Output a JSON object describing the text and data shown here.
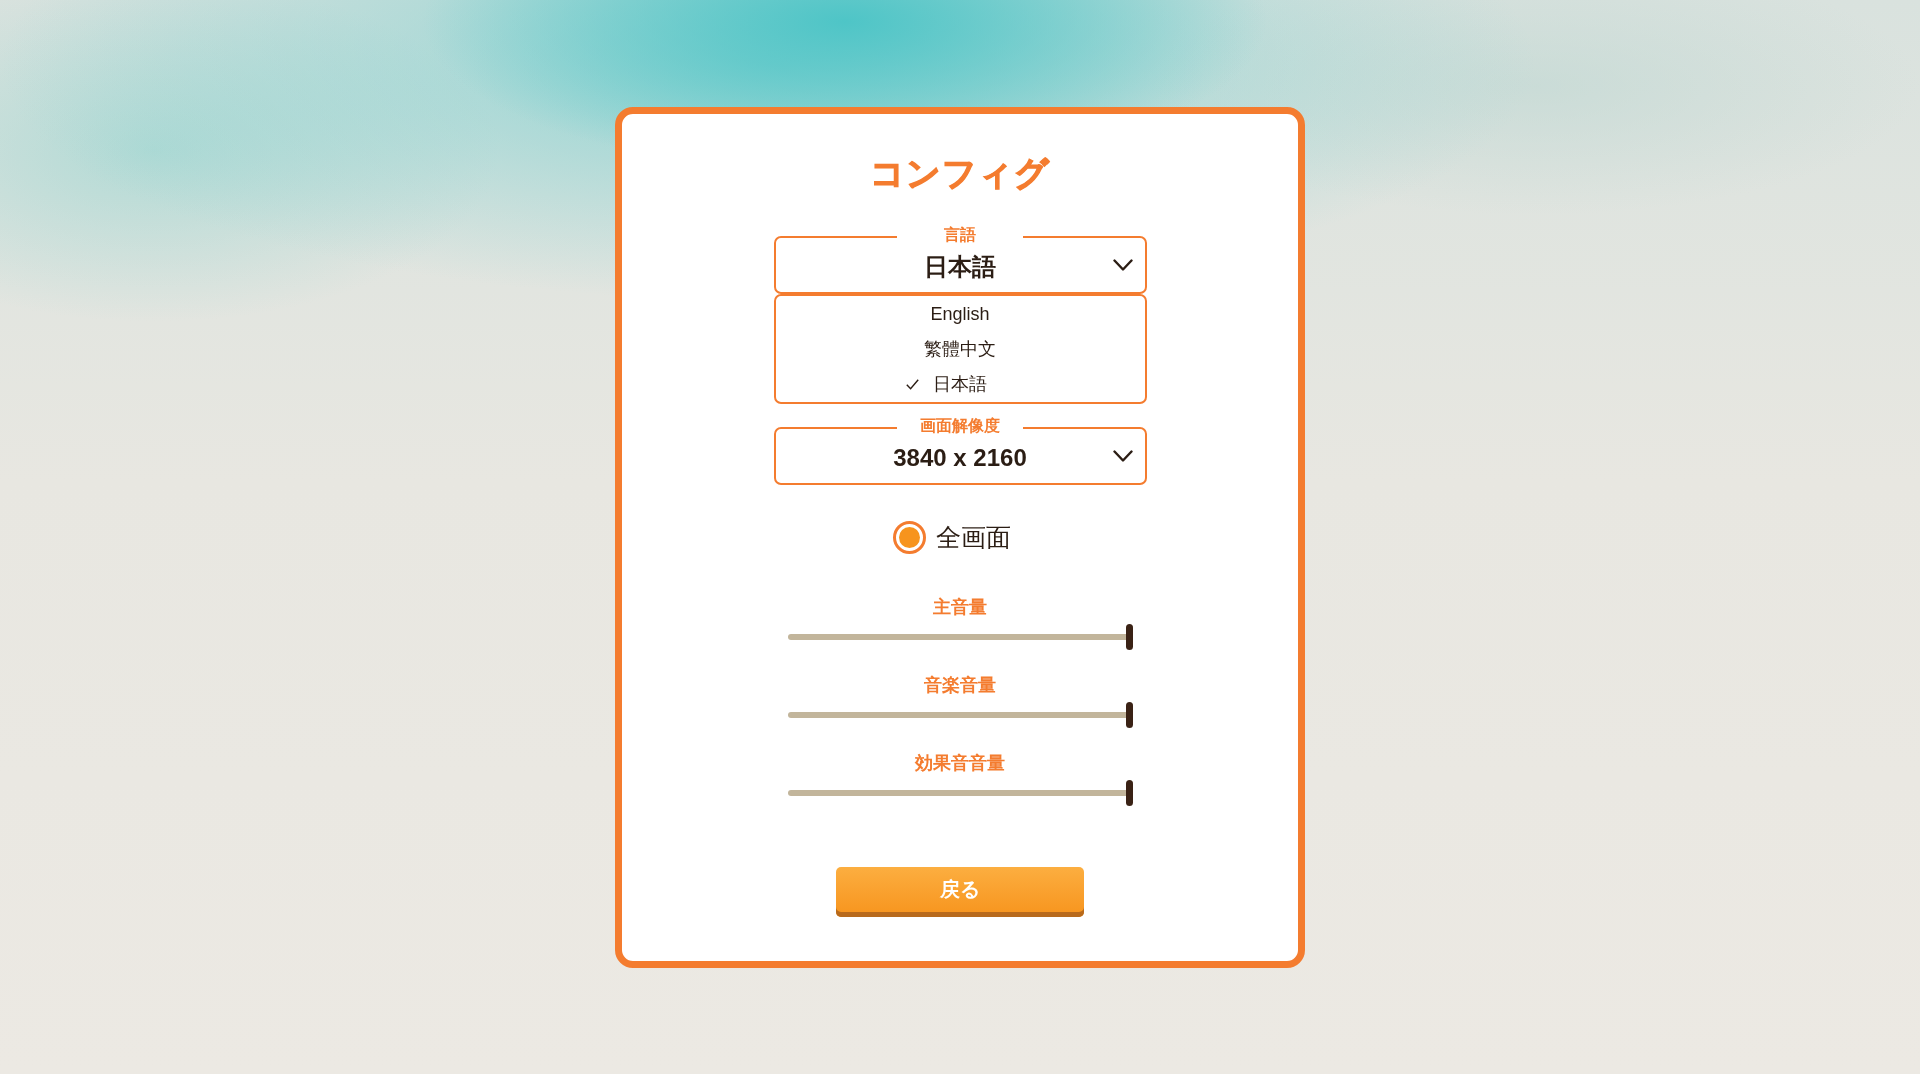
{
  "title": "コンフィグ",
  "language": {
    "label": "言語",
    "value": "日本語",
    "expanded": true,
    "options": [
      {
        "label": "English",
        "selected": false
      },
      {
        "label": "繁體中文",
        "selected": false
      },
      {
        "label": "日本語",
        "selected": true
      }
    ]
  },
  "resolution": {
    "label": "画面解像度",
    "value": "3840 x 2160"
  },
  "fullscreen": {
    "label": "全画面",
    "checked": true
  },
  "volumes": [
    {
      "label": "主音量",
      "level": 1
    },
    {
      "label": "音楽音量",
      "level": 1
    },
    {
      "label": "効果音音量",
      "level": 1
    }
  ],
  "back_button": "戻る"
}
